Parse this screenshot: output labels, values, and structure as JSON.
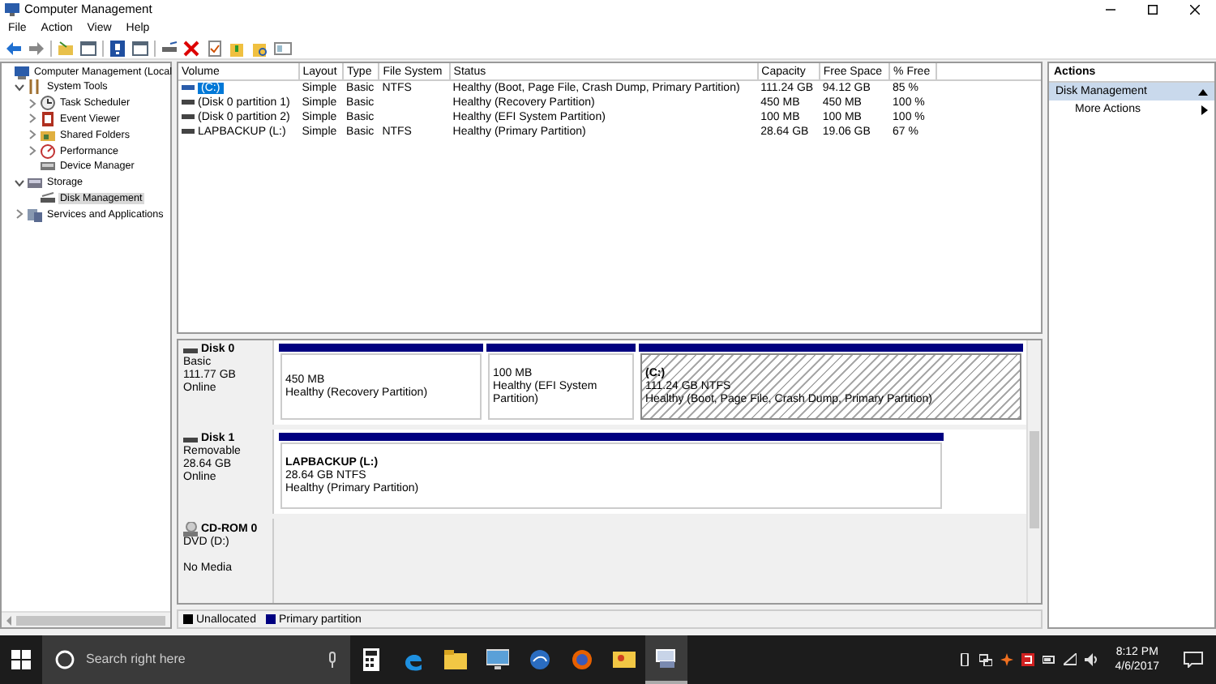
{
  "window": {
    "title": "Computer Management"
  },
  "menu": [
    "File",
    "Action",
    "View",
    "Help"
  ],
  "tree": [
    {
      "label": "Computer Management (Local",
      "children": [
        {
          "label": "System Tools",
          "expanded": true,
          "children": [
            {
              "label": "Task Scheduler",
              "expanded": false
            },
            {
              "label": "Event Viewer",
              "expanded": false
            },
            {
              "label": "Shared Folders",
              "expanded": false
            },
            {
              "label": "Performance",
              "expanded": false
            },
            {
              "label": "Device Manager"
            }
          ]
        },
        {
          "label": "Storage",
          "expanded": true,
          "children": [
            {
              "label": "Disk Management",
              "selected": true
            }
          ]
        },
        {
          "label": "Services and Applications",
          "expanded": false
        }
      ]
    }
  ],
  "volumes": {
    "columns": [
      "Volume",
      "Layout",
      "Type",
      "File System",
      "Status",
      "Capacity",
      "Free Space",
      "% Free"
    ],
    "rows": [
      {
        "cells": [
          "(C:)",
          "Simple",
          "Basic",
          "NTFS",
          "Healthy (Boot, Page File, Crash Dump, Primary Partition)",
          "111.24 GB",
          "94.12 GB",
          "85 %"
        ],
        "selected": true
      },
      {
        "cells": [
          "(Disk 0 partition 1)",
          "Simple",
          "Basic",
          "",
          "Healthy (Recovery Partition)",
          "450 MB",
          "450 MB",
          "100 %"
        ],
        "selected": false
      },
      {
        "cells": [
          "(Disk 0 partition 2)",
          "Simple",
          "Basic",
          "",
          "Healthy (EFI System Partition)",
          "100 MB",
          "100 MB",
          "100 %"
        ],
        "selected": false
      },
      {
        "cells": [
          "LAPBACKUP (L:)",
          "Simple",
          "Basic",
          "NTFS",
          "Healthy (Primary Partition)",
          "28.64 GB",
          "19.06 GB",
          "67 %"
        ],
        "selected": false
      }
    ]
  },
  "disks": [
    {
      "name": "Disk 0",
      "kind": "disk",
      "lines": [
        "Basic",
        "111.77 GB",
        "Online"
      ],
      "partitions": [
        {
          "size": "450 MB",
          "status": "Healthy (Recovery Partition)",
          "selected": false
        },
        {
          "size": "100 MB",
          "status": "Healthy (EFI System Partition)",
          "selected": false
        },
        {
          "label": "(C:)",
          "size": "111.24 GB NTFS",
          "status": "Healthy (Boot, Page File, Crash Dump, Primary Partition)",
          "selected": true
        }
      ]
    },
    {
      "name": "Disk 1",
      "kind": "disk",
      "lines": [
        "Removable",
        "28.64 GB",
        "Online"
      ],
      "partitions": [
        {
          "label": "LAPBACKUP  (L:)",
          "size": "28.64 GB NTFS",
          "status": "Healthy (Primary Partition)",
          "selected": false
        }
      ]
    },
    {
      "name": "CD-ROM 0",
      "kind": "cdrom",
      "lines": [
        "DVD (D:)",
        "No Media"
      ]
    }
  ],
  "legend": [
    {
      "label": "Unallocated",
      "color": "#000000"
    },
    {
      "label": "Primary partition",
      "color": "#000080"
    }
  ],
  "actions": {
    "title": "Actions",
    "section": "Disk Management",
    "items": [
      "More Actions"
    ]
  },
  "taskbar": {
    "search": {
      "placeholder": "Search right here"
    },
    "time": "8:12 PM",
    "date": "4/6/2017"
  }
}
